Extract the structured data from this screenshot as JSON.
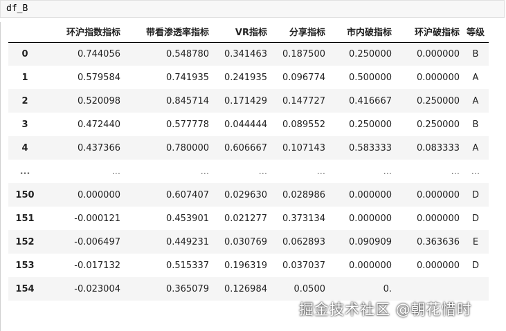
{
  "cell": {
    "code": "df_B"
  },
  "table": {
    "columns": [
      "环沪指数指标",
      "带看渗透率指标",
      "VR指标",
      "分享指标",
      "市内破指标",
      "环沪破指标",
      "等级"
    ],
    "rows": [
      {
        "index": "0",
        "cells": [
          "0.744056",
          "0.548780",
          "0.341463",
          "0.187500",
          "0.250000",
          "0.000000",
          "B"
        ]
      },
      {
        "index": "1",
        "cells": [
          "0.579584",
          "0.741935",
          "0.241935",
          "0.096774",
          "0.500000",
          "0.000000",
          "A"
        ]
      },
      {
        "index": "2",
        "cells": [
          "0.520098",
          "0.845714",
          "0.171429",
          "0.147727",
          "0.416667",
          "0.250000",
          "A"
        ]
      },
      {
        "index": "3",
        "cells": [
          "0.472440",
          "0.577778",
          "0.044444",
          "0.089552",
          "0.250000",
          "0.250000",
          "B"
        ]
      },
      {
        "index": "4",
        "cells": [
          "0.437366",
          "0.780000",
          "0.606667",
          "0.107143",
          "0.583333",
          "0.083333",
          "A"
        ]
      },
      {
        "index": "...",
        "cells": [
          "...",
          "...",
          "...",
          "...",
          "...",
          "...",
          "..."
        ]
      },
      {
        "index": "150",
        "cells": [
          "0.000000",
          "0.607407",
          "0.029630",
          "0.028986",
          "0.000000",
          "0.000000",
          "D"
        ]
      },
      {
        "index": "151",
        "cells": [
          "-0.000121",
          "0.453901",
          "0.021277",
          "0.373134",
          "0.000000",
          "0.000000",
          "D"
        ]
      },
      {
        "index": "152",
        "cells": [
          "-0.006497",
          "0.449231",
          "0.030769",
          "0.062893",
          "0.090909",
          "0.363636",
          "E"
        ]
      },
      {
        "index": "153",
        "cells": [
          "-0.017132",
          "0.515337",
          "0.196319",
          "0.037037",
          "0.000000",
          "0.000000",
          "D"
        ]
      },
      {
        "index": "154",
        "cells": [
          "-0.023004",
          "0.365079",
          "0.126984",
          "0.0500",
          "0.",
          "",
          ""
        ]
      }
    ]
  },
  "watermark": "掘金技术社区 @朝花惜时"
}
